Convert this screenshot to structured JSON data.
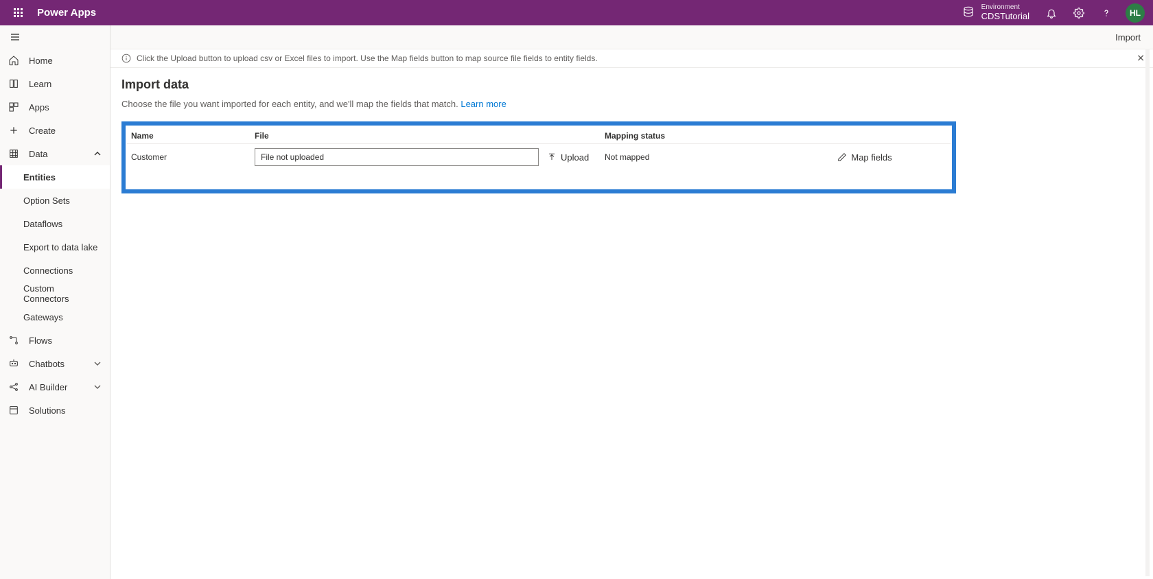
{
  "header": {
    "brand": "Power Apps",
    "environment_label": "Environment",
    "environment_name": "CDSTutorial",
    "avatar_initials": "HL"
  },
  "sidebar": {
    "home": "Home",
    "learn": "Learn",
    "apps": "Apps",
    "create": "Create",
    "data": "Data",
    "entities": "Entities",
    "option_sets": "Option Sets",
    "dataflows": "Dataflows",
    "export_lake": "Export to data lake",
    "connections": "Connections",
    "custom_connectors": "Custom Connectors",
    "gateways": "Gateways",
    "flows": "Flows",
    "chatbots": "Chatbots",
    "ai_builder": "AI Builder",
    "solutions": "Solutions"
  },
  "commandbar": {
    "import": "Import"
  },
  "infobar": {
    "text": "Click the Upload button to upload csv or Excel files to import. Use the Map fields button to map source file fields to entity fields."
  },
  "page": {
    "title": "Import data",
    "desc": "Choose the file you want imported for each entity, and we'll map the fields that match. ",
    "learn_more": "Learn more"
  },
  "table": {
    "col_name": "Name",
    "col_file": "File",
    "col_status": "Mapping status",
    "row": {
      "name": "Customer",
      "file_placeholder": "File not uploaded",
      "upload_label": "Upload",
      "status": "Not mapped",
      "map_label": "Map fields"
    }
  }
}
